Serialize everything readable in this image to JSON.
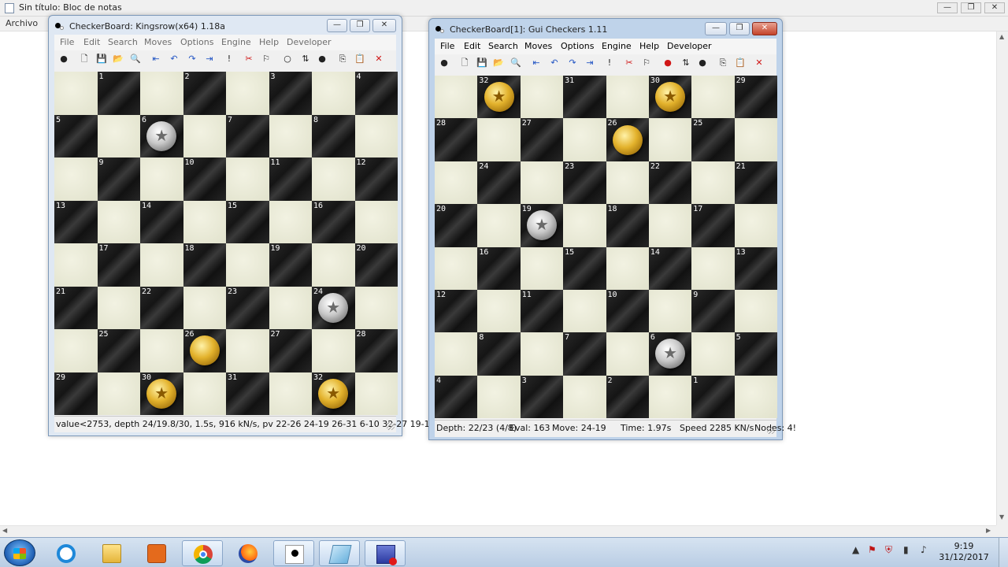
{
  "notepad": {
    "title": "Sin título: Bloc de notas",
    "menu_archivo": "Archivo",
    "minimize_glyph": "—",
    "maximize_glyph": "❐",
    "close_glyph": "✕"
  },
  "window_left": {
    "title": "CheckerBoard: Kingsrow(x64) 1.18a",
    "menu": [
      "File",
      "Edit",
      "Search",
      "Moves",
      "Options",
      "Engine",
      "Help",
      "Developer"
    ],
    "status": "value<2753,  depth 24/19.8/30,  1.5s,  916 kN/s,  pv 22-26 24-19 26-31 6-10 32-27 19-1",
    "board": {
      "orientation": "normal",
      "squares": [
        "1",
        "2",
        "3",
        "4",
        "5",
        "6",
        "7",
        "8",
        "9",
        "10",
        "11",
        "12",
        "13",
        "14",
        "15",
        "16",
        "17",
        "18",
        "19",
        "20",
        "21",
        "22",
        "23",
        "24",
        "25",
        "26",
        "27",
        "28",
        "29",
        "30",
        "31",
        "32"
      ],
      "pieces": [
        {
          "square": "6",
          "color": "white",
          "king": true
        },
        {
          "square": "24",
          "color": "white",
          "king": true
        },
        {
          "square": "26",
          "color": "gold",
          "king": false
        },
        {
          "square": "30",
          "color": "gold",
          "king": true
        },
        {
          "square": "32",
          "color": "gold",
          "king": true
        }
      ]
    }
  },
  "window_right": {
    "title": "CheckerBoard[1]: Gui Checkers 1.11",
    "menu": [
      "File",
      "Edit",
      "Search",
      "Moves",
      "Options",
      "Engine",
      "Help",
      "Developer"
    ],
    "status_items": [
      "Depth: 22/23 (4/8)",
      "Eval: 163",
      "Move: 24-19",
      "Time: 1.97s",
      "Speed 2285 KN/s",
      "Nodes: 4!"
    ],
    "board": {
      "orientation": "flipped",
      "pieces": [
        {
          "square": "32",
          "color": "gold",
          "king": true
        },
        {
          "square": "30",
          "color": "gold",
          "king": true
        },
        {
          "square": "26",
          "color": "gold",
          "king": false
        },
        {
          "square": "19",
          "color": "white",
          "king": true
        },
        {
          "square": "6",
          "color": "white",
          "king": true
        }
      ]
    }
  },
  "toolbar_left": [
    "board-icon",
    "new-icon",
    "save-icon",
    "open-icon",
    "find-icon",
    "first-icon",
    "undo-icon",
    "redo-icon",
    "last-icon",
    "play-icon",
    "stop-engine-icon",
    "two-player-icon",
    "circle-icon",
    "swap-icon",
    "user-icon",
    "copy-icon",
    "paste-icon",
    "close-icon"
  ],
  "toolbar_right": [
    "board-icon",
    "new-icon",
    "save-icon",
    "open-icon",
    "find-icon",
    "first-icon",
    "undo-icon",
    "redo-icon",
    "last-icon",
    "play-icon",
    "stop-engine-icon",
    "two-player-icon",
    "record-icon",
    "swap-icon",
    "user-icon",
    "copy-icon",
    "paste-icon",
    "close-icon"
  ],
  "taskbar": {
    "apps": [
      "start-orb",
      "internet-explorer",
      "file-explorer",
      "media-player",
      "chrome",
      "firefox",
      "checkerboard-app",
      "notepad",
      "checkerboard-save"
    ],
    "clock_time": "9:19",
    "clock_date": "31/12/2017"
  },
  "colors": {
    "light_square": "#e6e6d2",
    "dark_square": "#1c1c1c",
    "gold_piece": "#e3b22c",
    "white_piece": "#c8c8c8"
  }
}
